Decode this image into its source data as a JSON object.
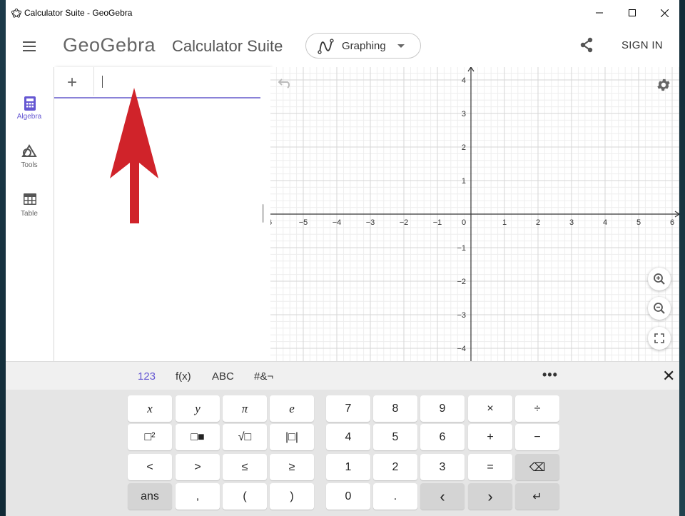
{
  "window": {
    "title": "Calculator Suite - GeoGebra"
  },
  "header": {
    "logo": "GeoGebra",
    "suite_name": "Calculator Suite",
    "app_picker_label": "Graphing",
    "sign_in_label": "SIGN IN"
  },
  "sidenav": {
    "items": [
      {
        "label": "Algebra",
        "icon": "calculator-icon",
        "active": true
      },
      {
        "label": "Tools",
        "icon": "shapes-icon",
        "active": false
      },
      {
        "label": "Table",
        "icon": "table-icon",
        "active": false
      }
    ]
  },
  "algebra": {
    "add_label": "+",
    "input_value": ""
  },
  "graphics": {
    "x_ticks": [
      "6",
      "−5",
      "−4",
      "−3",
      "−2",
      "−1",
      "0",
      "1",
      "2",
      "3",
      "4",
      "5",
      "6"
    ],
    "y_ticks_pos": [
      "4",
      "3",
      "2",
      "1"
    ],
    "y_ticks_neg": [
      "−1",
      "−2",
      "−3",
      "−4"
    ],
    "x_range": [
      -6,
      6
    ],
    "y_range": [
      -4,
      4
    ],
    "grid": true
  },
  "keyboard": {
    "tabs": [
      "123",
      "f(x)",
      "ABC",
      "#&¬"
    ],
    "active_tab": "123",
    "more_label": "•••",
    "close_label": "✕",
    "left_keys": [
      [
        "x",
        "y",
        "π",
        "e"
      ],
      [
        "□²",
        "□■",
        "√□",
        "|□|"
      ],
      [
        "<",
        ">",
        "≤",
        "≥"
      ],
      [
        "ans",
        ",",
        "(",
        ")"
      ]
    ],
    "right_keys": [
      [
        "7",
        "8",
        "9",
        "×",
        "÷"
      ],
      [
        "4",
        "5",
        "6",
        "+",
        "−"
      ],
      [
        "1",
        "2",
        "3",
        "=",
        "⌫"
      ],
      [
        "0",
        ".",
        "‹",
        "›",
        "↵"
      ]
    ]
  },
  "colors": {
    "accent": "#6557d2",
    "annotation_arrow": "#d0232a"
  }
}
